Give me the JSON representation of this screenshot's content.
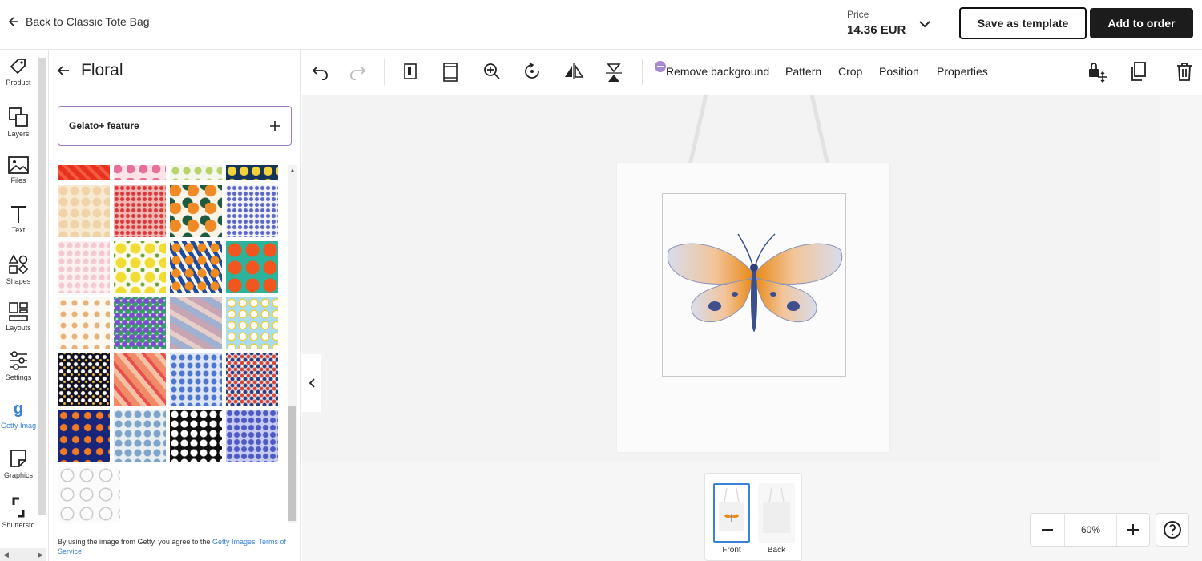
{
  "header": {
    "back_label": "Back to Classic Tote Bag",
    "price_label": "Price",
    "price_value": "14.36 EUR",
    "save_template_label": "Save as template",
    "add_to_order_label": "Add to order"
  },
  "rail": {
    "items": [
      {
        "label": "Product",
        "icon": "tag-icon"
      },
      {
        "label": "Layers",
        "icon": "layers-icon"
      },
      {
        "label": "Files",
        "icon": "image-icon"
      },
      {
        "label": "Text",
        "icon": "text-icon"
      },
      {
        "label": "Shapes",
        "icon": "shapes-icon"
      },
      {
        "label": "Layouts",
        "icon": "layouts-icon"
      },
      {
        "label": "Settings",
        "icon": "sliders-icon"
      },
      {
        "label": "Getty Imag",
        "icon": "getty-icon"
      },
      {
        "label": "Graphics",
        "icon": "sticker-icon"
      },
      {
        "label": "Shuttersto",
        "icon": "shutterstock-icon"
      }
    ],
    "active": "Getty Imag",
    "accent": "#3b82d6"
  },
  "panel": {
    "title": "Floral",
    "feature_label": "Gelato+ feature",
    "footer_prefix": "By using the image from Getty, you agree to the ",
    "footer_link": "Getty Images' Terms of Service",
    "patterns": [
      "red-pattern",
      "pink-floral",
      "lime-floral",
      "lemon-navy",
      "cream-floral",
      "red-ditsy",
      "tropical-orange",
      "blue-ditsy",
      "blush-floral",
      "lemons",
      "orange-blue-leaves",
      "oranges-teal",
      "line-floral",
      "violet-floral",
      "dusty-abstract",
      "daisy-blue",
      "black-daisy",
      "coral-leaves",
      "blue-floral",
      "navy-red-floral",
      "navy-orange",
      "grey-blue-floral",
      "black-white-leaves",
      "periwinkle-floral",
      "sketch-roses"
    ]
  },
  "toolbar": {
    "remove_bg_label": "Remove background",
    "pattern_label": "Pattern",
    "crop_label": "Crop",
    "position_label": "Position",
    "properties_label": "Properties"
  },
  "sides": {
    "front_label": "Front",
    "back_label": "Back",
    "selected": "Front"
  },
  "zoom": {
    "value": "60%"
  }
}
